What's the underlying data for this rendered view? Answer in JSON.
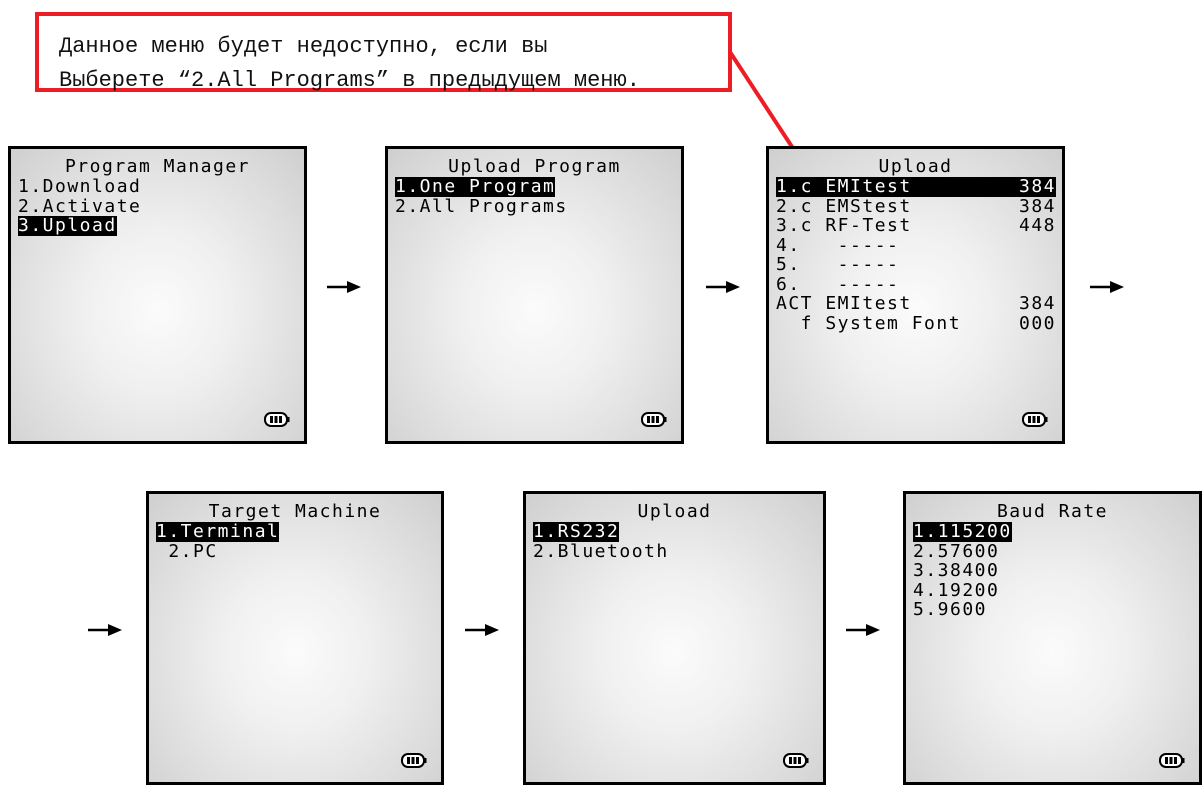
{
  "note": {
    "line1": "Данное меню будет недоступно, если вы",
    "line2": "Выберете “2.All Programs” в предыдущем меню."
  },
  "screens": [
    {
      "title": "Program Manager",
      "items": [
        {
          "label": "1.Download",
          "value": "",
          "selected": false
        },
        {
          "label": "2.Activate",
          "value": "",
          "selected": false
        },
        {
          "label": "3.Upload",
          "value": "",
          "selected": true
        }
      ]
    },
    {
      "title": "Upload Program",
      "items": [
        {
          "label": "1.One Program",
          "value": "",
          "selected": true
        },
        {
          "label": "2.All Programs",
          "value": "",
          "selected": false
        }
      ]
    },
    {
      "title": "Upload",
      "items": [
        {
          "label": "1.c EMItest",
          "value": "384",
          "selected": true
        },
        {
          "label": "2.c EMStest",
          "value": "384",
          "selected": false
        },
        {
          "label": "3.c RF-Test",
          "value": "448",
          "selected": false
        },
        {
          "label": "4.   -----",
          "value": "",
          "selected": false
        },
        {
          "label": "5.   -----",
          "value": "",
          "selected": false
        },
        {
          "label": "6.   -----",
          "value": "",
          "selected": false
        },
        {
          "label": "ACT EMItest",
          "value": "384",
          "selected": false
        },
        {
          "label": "  f System Font",
          "value": "000",
          "selected": false
        }
      ]
    },
    {
      "title": "Target Machine",
      "items": [
        {
          "label": "1.Terminal",
          "value": "",
          "selected": true
        },
        {
          "label": " 2.PC",
          "value": "",
          "selected": false
        }
      ]
    },
    {
      "title": "Upload",
      "items": [
        {
          "label": "1.RS232",
          "value": "",
          "selected": true
        },
        {
          "label": "2.Bluetooth",
          "value": "",
          "selected": false
        }
      ]
    },
    {
      "title": "Baud Rate",
      "items": [
        {
          "label": "1.115200",
          "value": "",
          "selected": true
        },
        {
          "label": "2.57600",
          "value": "",
          "selected": false
        },
        {
          "label": "3.38400",
          "value": "",
          "selected": false
        },
        {
          "label": "4.19200",
          "value": "",
          "selected": false
        },
        {
          "label": "5.9600",
          "value": "",
          "selected": false
        }
      ]
    }
  ],
  "colors": {
    "highlight": "#ee1c25",
    "selection": "#000000"
  }
}
